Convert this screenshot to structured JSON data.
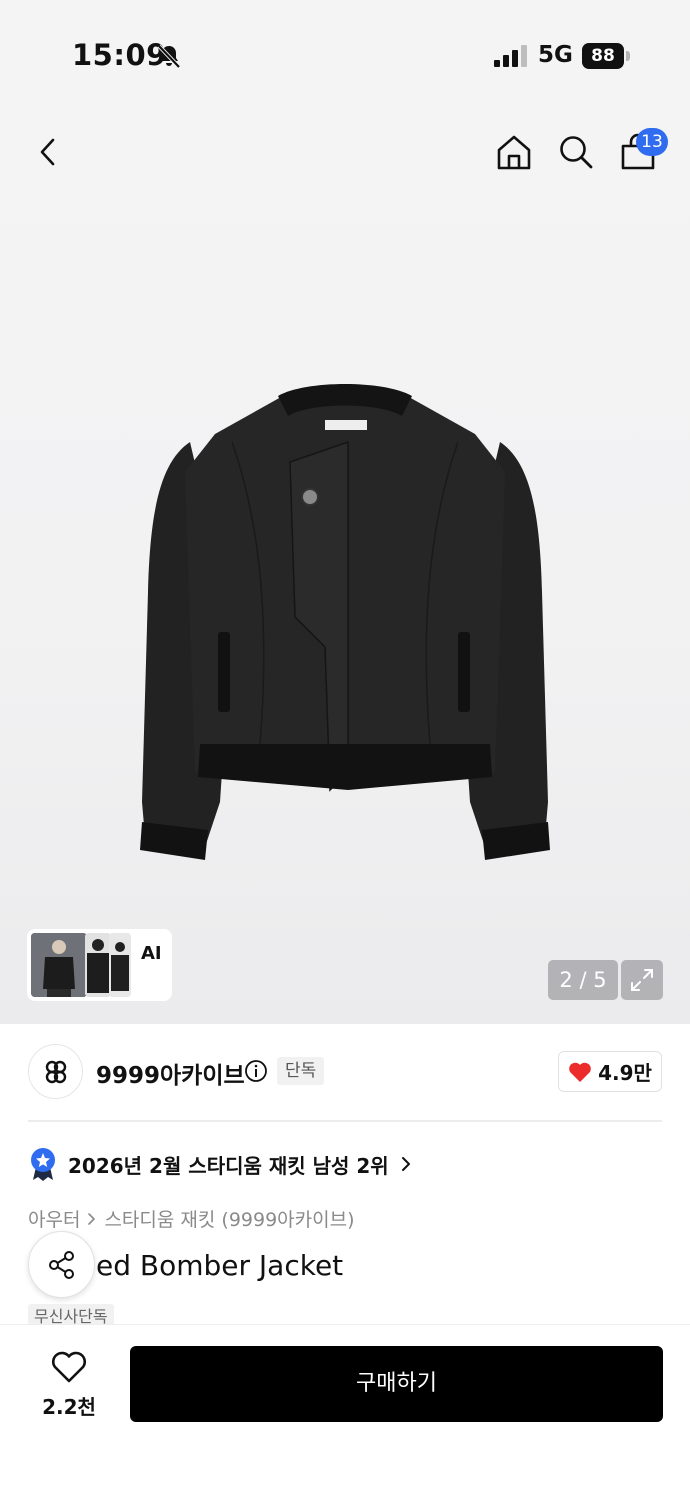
{
  "status_bar": {
    "time": "15:09",
    "network": "5G",
    "battery": "88"
  },
  "nav": {
    "cart_badge": "13"
  },
  "gallery": {
    "ai_label": "AI",
    "counter": "2 / 5"
  },
  "brand": {
    "name": "9999아카이브",
    "exclusive_tag": "단독",
    "likes": "4.9만"
  },
  "ranking": {
    "text": "2026년 2월 스타디움 재킷 남성 2위"
  },
  "breadcrumb": {
    "category": "아우터",
    "subcategory": "스타디움 재킷 (9999아카이브)"
  },
  "product": {
    "title_visible": "ed Bomber Jacket",
    "tag": "무신사단독"
  },
  "bottom_bar": {
    "wish_count": "2.2천",
    "buy_label": "구매하기"
  },
  "colors": {
    "accent_blue": "#2f6cf0",
    "heart_red": "#ec2b2b",
    "buy_bg": "#000000"
  },
  "icons": [
    "bell-slash-icon",
    "signal-icon",
    "battery-icon",
    "back-icon",
    "home-icon",
    "search-icon",
    "cart-icon",
    "chevron-right-icon",
    "expand-icon",
    "info-icon",
    "heart-icon",
    "badge-star-icon",
    "share-icon",
    "heart-outline-icon"
  ]
}
